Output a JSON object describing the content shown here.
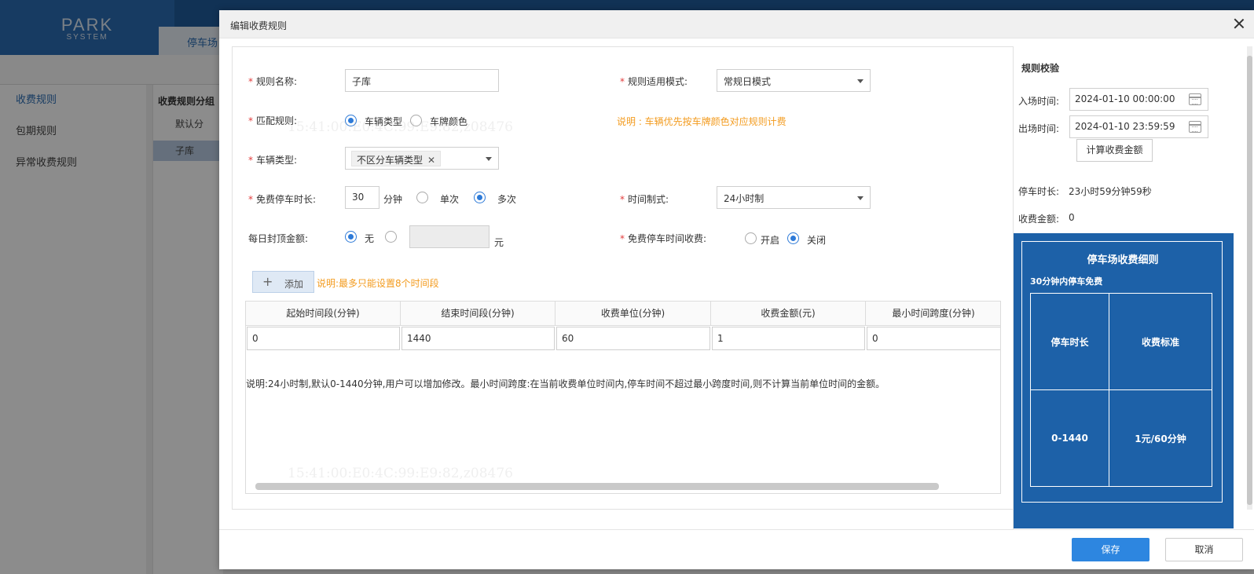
{
  "background": {
    "logo_big": "PARK",
    "logo_small": "SYSTEM",
    "top_tab": "停车场",
    "left_menu": [
      "收费规则",
      "包期规则",
      "异常收费规则"
    ],
    "group_title": "收费规则分组",
    "group_items": [
      "默认分",
      "子库"
    ]
  },
  "modal": {
    "title": "编辑收费规则",
    "form": {
      "rule_name_label": "规则名称:",
      "rule_name_value": "子库",
      "mode_label": "规则适用模式:",
      "mode_value": "常规日模式",
      "match_label": "匹配规则:",
      "match_opt1": "车辆类型",
      "match_opt2": "车牌颜色",
      "match_note": "说明 : 车辆优先按车牌颜色对应规则计费",
      "vehicle_label": "车辆类型:",
      "vehicle_tag": "不区分车辆类型",
      "free_label": "免费停车时长:",
      "free_value": "30",
      "free_unit": "分钟",
      "free_opt1": "单次",
      "free_opt2": "多次",
      "time_sys_label": "时间制式:",
      "time_sys_value": "24小时制",
      "cap_label": "每日封顶金额:",
      "cap_opt1": "无",
      "cap_unit": "元",
      "free_charge_label": "免费停车时间收费:",
      "free_charge_opt1": "开启",
      "free_charge_opt2": "关闭",
      "add_button": "添加",
      "add_note": "说明:最多只能设置8个时间段"
    },
    "table": {
      "headers": [
        "起始时间段(分钟)",
        "结束时间段(分钟)",
        "收费单位(分钟)",
        "收费金额(元)",
        "最小时间跨度(分钟)"
      ],
      "row": [
        "0",
        "1440",
        "60",
        "1",
        "0"
      ],
      "note": "说明:24小时制,默认0-1440分钟,用户可以增加修改。最小时间跨度:在当前收费单位时间内,停车时间不超过最小跨度时间,则不计算当前单位时间的金额。"
    },
    "verify": {
      "title": "规则校验",
      "entry_label": "入场时间:",
      "entry_value": "2024-01-10 00:00:00",
      "exit_label": "出场时间:",
      "exit_value": "2024-01-10 23:59:59",
      "calc_button": "计算收费金额",
      "duration_label": "停车时长:",
      "duration_value": "23小时59分钟59秒",
      "amount_label": "收费金额:",
      "amount_value": "0"
    },
    "detail": {
      "title": "停车场收费细则",
      "subtitle": "30分钟内停车免费",
      "col1": "停车时长",
      "col2": "收费标准",
      "val1": "0-1440",
      "val2": "1元/60分钟"
    },
    "footer": {
      "save": "保存",
      "cancel": "取消"
    },
    "watermark": "15:41:00:E0:4C:99:E9:82,z08476"
  },
  "colors": {
    "accent": "#2d86e0",
    "note_orange": "#f39b1e",
    "detail_blue": "#1d61a8",
    "required_red": "#e23c3c"
  }
}
